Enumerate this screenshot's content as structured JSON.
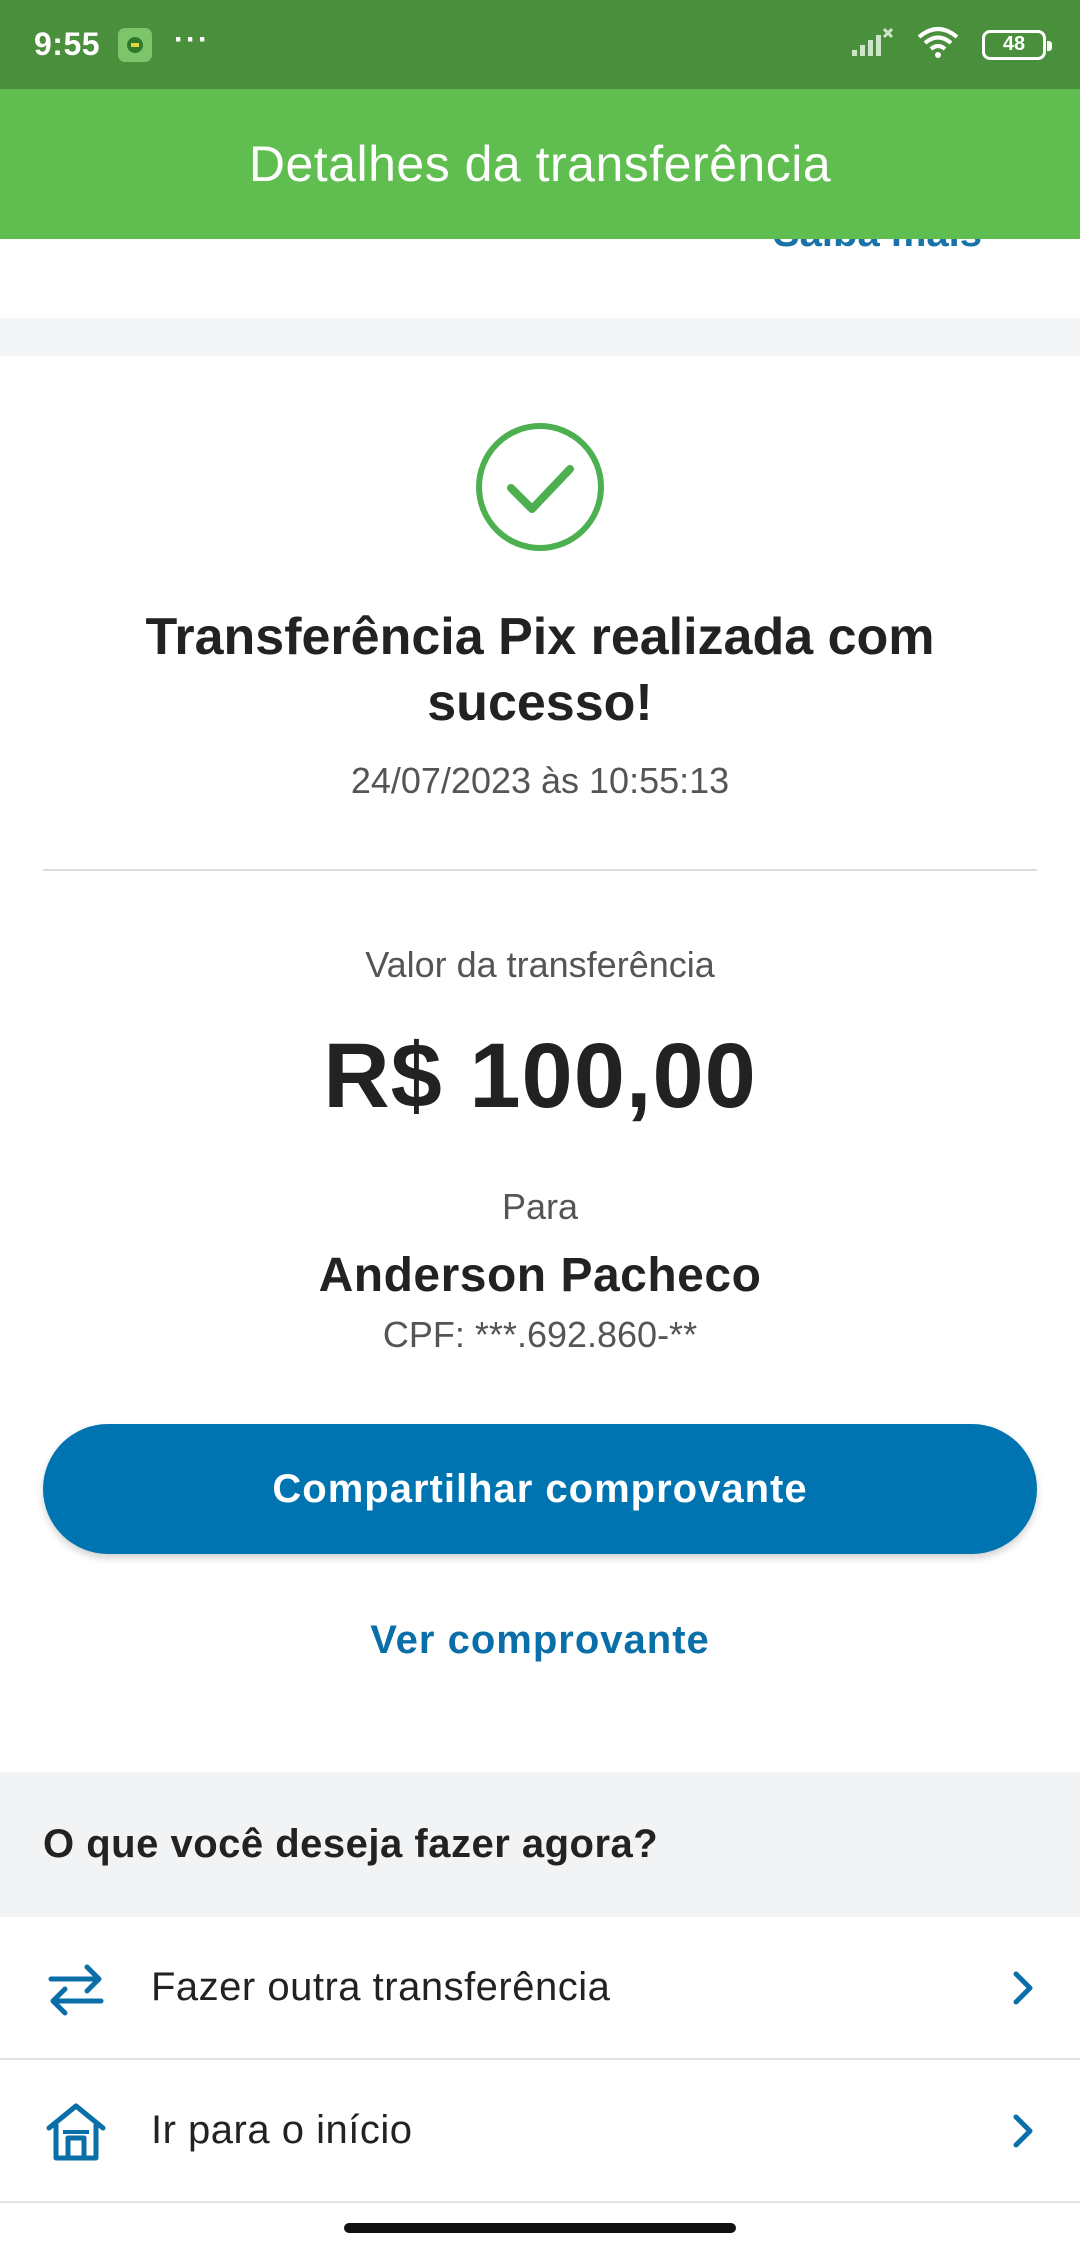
{
  "status_bar": {
    "time": "9:55",
    "dots": "···",
    "battery": "48",
    "icons": [
      "app-notification-icon",
      "signal-icon",
      "wifi-icon",
      "battery-icon"
    ]
  },
  "app_bar": {
    "title": "Detalhes da transferência"
  },
  "top_card": {
    "link_label": "Saiba mais"
  },
  "receipt": {
    "status_icon": "check-circle-icon",
    "title": "Transferência Pix realizada com sucesso!",
    "datetime": "24/07/2023 às 10:55:13",
    "amount_label": "Valor da transferência",
    "amount_value": "R$ 100,00",
    "recipient_label": "Para",
    "recipient_name": "Anderson Pacheco",
    "recipient_document": "CPF: ***.692.860-**"
  },
  "buttons": {
    "share": "Compartilhar comprovante",
    "view": "Ver comprovante"
  },
  "next_actions": {
    "title": "O que você deseja fazer agora?",
    "items": [
      {
        "label": "Fazer outra transferência",
        "icon": "transfer-arrows-icon"
      },
      {
        "label": "Ir para o início",
        "icon": "home-icon"
      }
    ]
  },
  "colors": {
    "status_bar": "#4a8f3c",
    "app_bar": "#5fbe4f",
    "primary_blue": "#0074b0",
    "success_green": "#4caf50"
  }
}
